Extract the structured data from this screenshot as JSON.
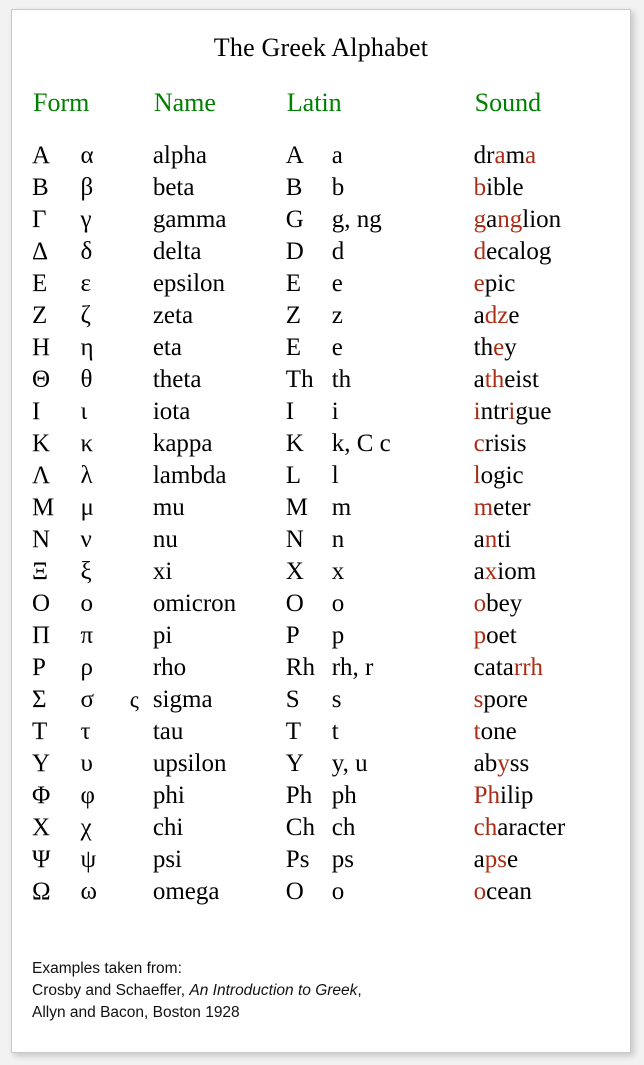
{
  "title": "The Greek Alphabet",
  "headers": {
    "form": "Form",
    "name": "Name",
    "latin": "Latin",
    "sound": "Sound"
  },
  "colors": {
    "header_green": "#008000",
    "highlight_red": "#a92d16",
    "text_black": "#000000",
    "page_background": "#f2f2f2",
    "card_background": "#ffffff"
  },
  "rows": [
    {
      "upper": "Α",
      "lower": "α",
      "final": "",
      "name": "alpha",
      "latin_upper": "A",
      "latin_lower": "a",
      "sound_parts": [
        {
          "t": "dr",
          "hl": false
        },
        {
          "t": "a",
          "hl": true
        },
        {
          "t": "m",
          "hl": false
        },
        {
          "t": "a",
          "hl": true
        }
      ]
    },
    {
      "upper": "Β",
      "lower": "β",
      "final": "",
      "name": "beta",
      "latin_upper": "B",
      "latin_lower": "b",
      "sound_parts": [
        {
          "t": "b",
          "hl": true
        },
        {
          "t": "ible",
          "hl": false
        }
      ]
    },
    {
      "upper": "Γ",
      "lower": "γ",
      "final": "",
      "name": "gamma",
      "latin_upper": "G",
      "latin_lower": "g, ng",
      "sound_parts": [
        {
          "t": "g",
          "hl": true
        },
        {
          "t": "a",
          "hl": false
        },
        {
          "t": "ng",
          "hl": true
        },
        {
          "t": "lion",
          "hl": false
        }
      ]
    },
    {
      "upper": "Δ",
      "lower": "δ",
      "final": "",
      "name": "delta",
      "latin_upper": "D",
      "latin_lower": "d",
      "sound_parts": [
        {
          "t": "d",
          "hl": true
        },
        {
          "t": "ecalog",
          "hl": false
        }
      ]
    },
    {
      "upper": "Ε",
      "lower": "ε",
      "final": "",
      "name": "epsilon",
      "latin_upper": "E",
      "latin_lower": "e",
      "sound_parts": [
        {
          "t": "e",
          "hl": true
        },
        {
          "t": "pic",
          "hl": false
        }
      ]
    },
    {
      "upper": "Ζ",
      "lower": "ζ",
      "final": "",
      "name": "zeta",
      "latin_upper": "Z",
      "latin_lower": "z",
      "sound_parts": [
        {
          "t": "a",
          "hl": false
        },
        {
          "t": "dz",
          "hl": true
        },
        {
          "t": "e",
          "hl": false
        }
      ]
    },
    {
      "upper": "Η",
      "lower": "η",
      "final": "",
      "name": "eta",
      "latin_upper": "E",
      "latin_lower": "e",
      "sound_parts": [
        {
          "t": "th",
          "hl": false
        },
        {
          "t": "e",
          "hl": true
        },
        {
          "t": "y",
          "hl": false
        }
      ]
    },
    {
      "upper": "Θ",
      "lower": "θ",
      "final": "",
      "name": "theta",
      "latin_upper": "Th",
      "latin_lower": "th",
      "sound_parts": [
        {
          "t": "a",
          "hl": false
        },
        {
          "t": "th",
          "hl": true
        },
        {
          "t": "eist",
          "hl": false
        }
      ]
    },
    {
      "upper": "Ι",
      "lower": "ι",
      "final": "",
      "name": "iota",
      "latin_upper": "I",
      "latin_lower": "i",
      "sound_parts": [
        {
          "t": "i",
          "hl": true
        },
        {
          "t": "ntr",
          "hl": false
        },
        {
          "t": "i",
          "hl": true
        },
        {
          "t": "gue",
          "hl": false
        }
      ]
    },
    {
      "upper": "Κ",
      "lower": "κ",
      "final": "",
      "name": "kappa",
      "latin_upper": "K",
      "latin_lower": "k, C c",
      "sound_parts": [
        {
          "t": "c",
          "hl": true
        },
        {
          "t": "risis",
          "hl": false
        }
      ]
    },
    {
      "upper": "Λ",
      "lower": "λ",
      "final": "",
      "name": "lambda",
      "latin_upper": "L",
      "latin_lower": "l",
      "sound_parts": [
        {
          "t": "l",
          "hl": true
        },
        {
          "t": "ogic",
          "hl": false
        }
      ]
    },
    {
      "upper": "Μ",
      "lower": "μ",
      "final": "",
      "name": "mu",
      "latin_upper": "M",
      "latin_lower": "m",
      "sound_parts": [
        {
          "t": "m",
          "hl": true
        },
        {
          "t": "eter",
          "hl": false
        }
      ]
    },
    {
      "upper": "Ν",
      "lower": "ν",
      "final": "",
      "name": "nu",
      "latin_upper": "N",
      "latin_lower": "n",
      "sound_parts": [
        {
          "t": "a",
          "hl": false
        },
        {
          "t": "n",
          "hl": true
        },
        {
          "t": "ti",
          "hl": false
        }
      ]
    },
    {
      "upper": "Ξ",
      "lower": "ξ",
      "final": "",
      "name": "xi",
      "latin_upper": "X",
      "latin_lower": "x",
      "sound_parts": [
        {
          "t": "a",
          "hl": false
        },
        {
          "t": "x",
          "hl": true
        },
        {
          "t": "iom",
          "hl": false
        }
      ]
    },
    {
      "upper": "Ο",
      "lower": "ο",
      "final": "",
      "name": "omicron",
      "latin_upper": "O",
      "latin_lower": "o",
      "sound_parts": [
        {
          "t": "o",
          "hl": true
        },
        {
          "t": "bey",
          "hl": false
        }
      ]
    },
    {
      "upper": "Π",
      "lower": "π",
      "final": "",
      "name": "pi",
      "latin_upper": "P",
      "latin_lower": "p",
      "sound_parts": [
        {
          "t": "p",
          "hl": true
        },
        {
          "t": "oet",
          "hl": false
        }
      ]
    },
    {
      "upper": "Ρ",
      "lower": "ρ",
      "final": "",
      "name": "rho",
      "latin_upper": "Rh",
      "latin_lower": "rh, r",
      "sound_parts": [
        {
          "t": "cata",
          "hl": false
        },
        {
          "t": "rrh",
          "hl": true
        }
      ]
    },
    {
      "upper": "Σ",
      "lower": "σ",
      "final": "ς",
      "name": "sigma",
      "latin_upper": "S",
      "latin_lower": "s",
      "sound_parts": [
        {
          "t": "s",
          "hl": true
        },
        {
          "t": "pore",
          "hl": false
        }
      ]
    },
    {
      "upper": "Τ",
      "lower": "τ",
      "final": "",
      "name": "tau",
      "latin_upper": "T",
      "latin_lower": "t",
      "sound_parts": [
        {
          "t": "t",
          "hl": true
        },
        {
          "t": "one",
          "hl": false
        }
      ]
    },
    {
      "upper": "Υ",
      "lower": "υ",
      "final": "",
      "name": "upsilon",
      "latin_upper": "Y",
      "latin_lower": "y, u",
      "sound_parts": [
        {
          "t": "ab",
          "hl": false
        },
        {
          "t": "y",
          "hl": true
        },
        {
          "t": "ss",
          "hl": false
        }
      ]
    },
    {
      "upper": "Φ",
      "lower": "φ",
      "final": "",
      "name": "phi",
      "latin_upper": "Ph",
      "latin_lower": "ph",
      "sound_parts": [
        {
          "t": "Ph",
          "hl": true
        },
        {
          "t": "ilip",
          "hl": false
        }
      ]
    },
    {
      "upper": "Χ",
      "lower": "χ",
      "final": "",
      "name": "chi",
      "latin_upper": "Ch",
      "latin_lower": "ch",
      "sound_parts": [
        {
          "t": "ch",
          "hl": true
        },
        {
          "t": "aracter",
          "hl": false
        }
      ]
    },
    {
      "upper": "Ψ",
      "lower": "ψ",
      "final": "",
      "name": "psi",
      "latin_upper": "Ps",
      "latin_lower": "ps",
      "sound_parts": [
        {
          "t": "a",
          "hl": false
        },
        {
          "t": "ps",
          "hl": true
        },
        {
          "t": "e",
          "hl": false
        }
      ]
    },
    {
      "upper": "Ω",
      "lower": "ω",
      "final": "",
      "name": "omega",
      "latin_upper": "O",
      "latin_lower": "o",
      "sound_parts": [
        {
          "t": "o",
          "hl": true
        },
        {
          "t": "cean",
          "hl": false
        }
      ]
    }
  ],
  "footer": {
    "line1": "Examples taken from:",
    "line2_pre": "Crosby and Schaeffer, ",
    "line2_italic": "An Introduction to Greek",
    "line2_post": ",",
    "line3": "Allyn and Bacon, Boston 1928"
  }
}
